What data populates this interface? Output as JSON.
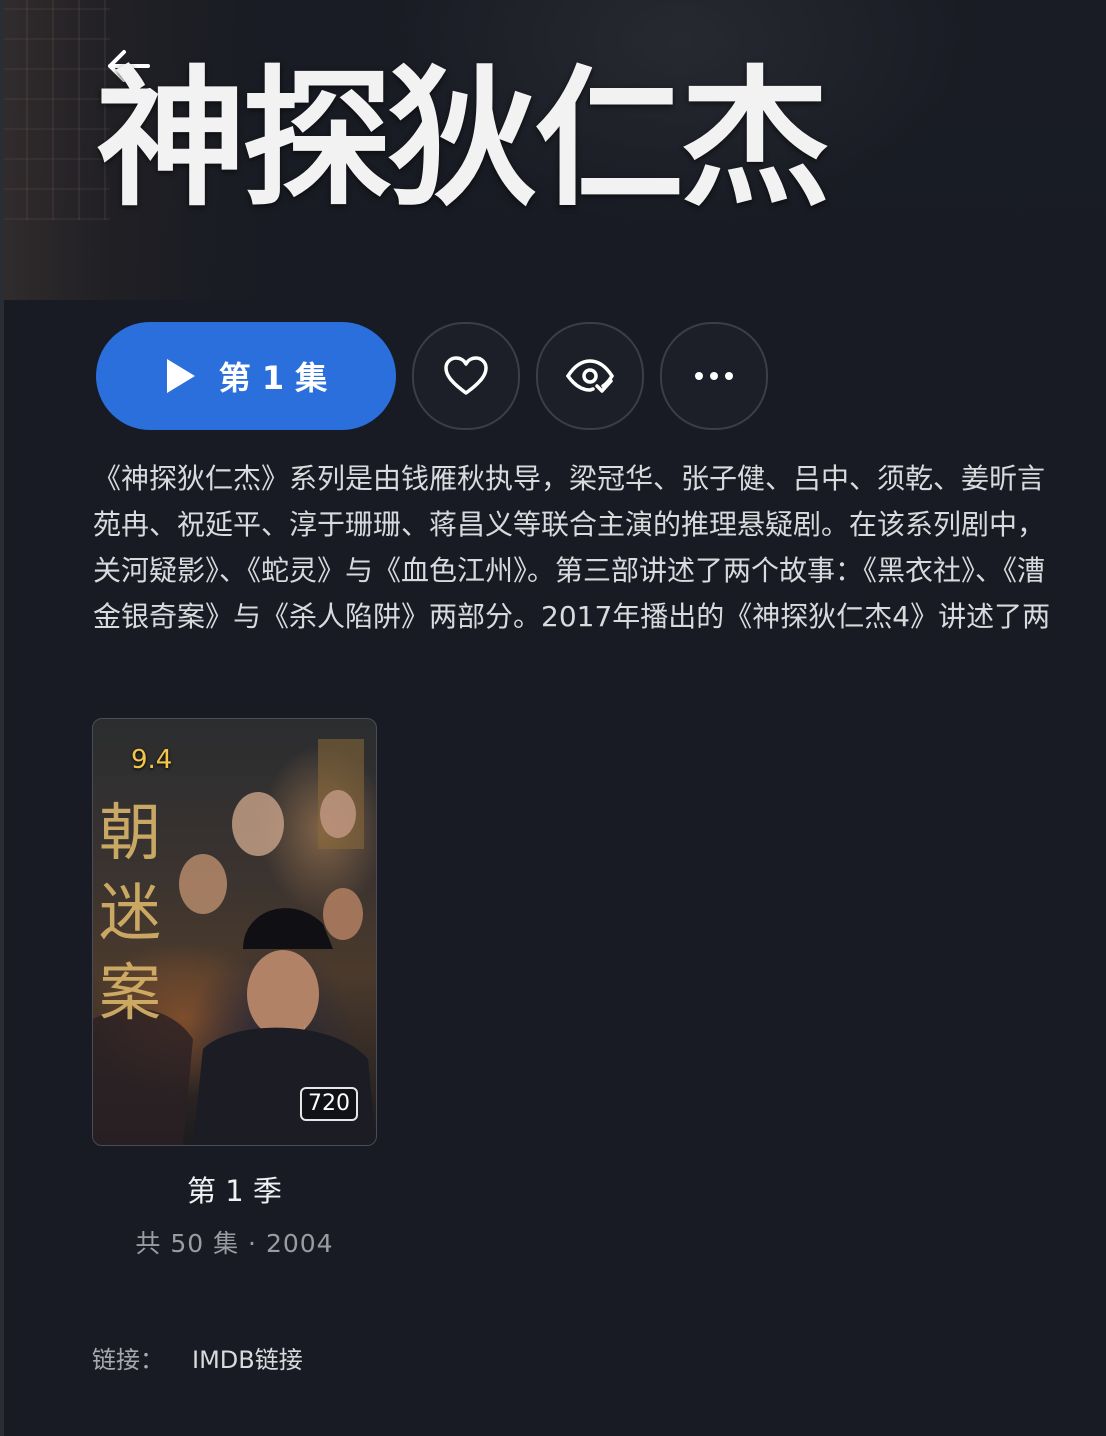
{
  "header": {
    "back_icon": "arrow-left-icon",
    "title": "神探狄仁杰"
  },
  "actions": {
    "play_label": "第 1 集",
    "play_icon": "play-icon",
    "favorite_icon": "heart-icon",
    "watched_icon": "eye-check-icon",
    "more_icon": "more-horizontal-icon",
    "accent_color": "#2a6fdc"
  },
  "description": {
    "lines": [
      "《神探狄仁杰》系列是由钱雁秋执导，梁冠华、张子健、吕中、须乾、姜昕言",
      "苑冉、祝延平、淳于珊珊、蒋昌义等联合主演的推理悬疑剧。在该系列剧中，",
      "关河疑影》、《蛇灵》与《血色江州》。第三部讲述了两个故事：《黑衣社》、《漕",
      "金银奇案》与《杀人陷阱》两部分。2017年播出的《神探狄仁杰4》讲述了两"
    ]
  },
  "seasons": [
    {
      "title": "第 1 季",
      "meta": "共 50 集 · 2004",
      "rating": "9.4",
      "quality": "720",
      "rating_color": "#f3c64a"
    }
  ],
  "links": {
    "label": "链接：",
    "imdb": "IMDB链接"
  }
}
